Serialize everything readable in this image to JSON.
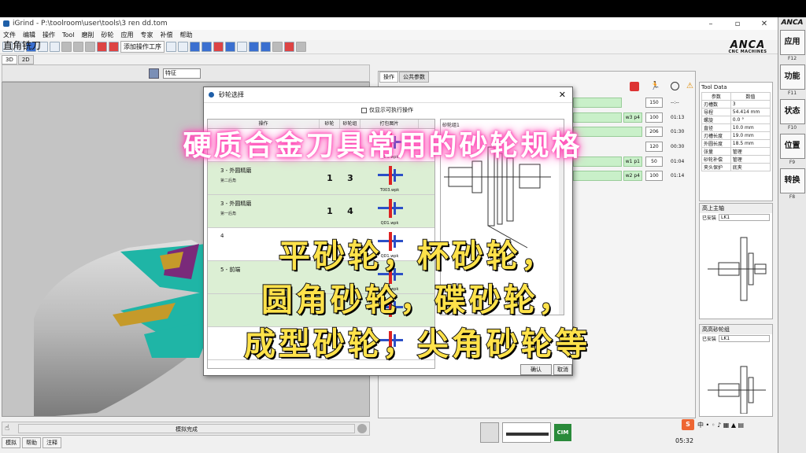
{
  "window": {
    "title": "iGrind - P:\\toolroom\\user\\tools\\3 ren dd.tom"
  },
  "menu": [
    "文件",
    "编辑",
    "操作",
    "Tool",
    "磨削",
    "砂轮",
    "应用",
    "专家",
    "补偿",
    "帮助"
  ],
  "toolbar": {
    "add_op_label": "添加操作工序"
  },
  "page_title": "直角铣刀",
  "brand": {
    "name": "ANCA",
    "sub": "CNC MACHINES"
  },
  "view_tabs": [
    "3D",
    "2D"
  ],
  "view": {
    "feature_select": "特征"
  },
  "sim_status": "模拟完成",
  "status_tabs": [
    "模拟",
    "帮助",
    "注释"
  ],
  "right_panel": {
    "tabs": [
      "操作",
      "公共参数"
    ],
    "rows": [
      {
        "label": "w3 p4",
        "num": "100",
        "time": "01:13"
      },
      {
        "label": "",
        "num": "206",
        "time": "01:30"
      },
      {
        "label": "",
        "num": "120",
        "time": "00:30"
      },
      {
        "label": "w1 p1",
        "num": "50",
        "time": "01:04"
      },
      {
        "label": "w2 p4",
        "num": "100",
        "time": "01:14"
      }
    ],
    "top_num": "150",
    "top_time": "--:--"
  },
  "tool_data": {
    "title": "Tool Data",
    "headers": [
      "参数",
      "数值"
    ],
    "rows": [
      [
        "刃槽数",
        "3"
      ],
      [
        "导程",
        "54.414 mm"
      ],
      [
        "螺旋",
        "0.0 °"
      ],
      [
        "直径",
        "10.0 mm"
      ],
      [
        "刃槽长度",
        "19.0 mm"
      ],
      [
        "外圆长度",
        "18.5 mm"
      ],
      [
        "张量",
        "管理"
      ],
      [
        "砂轮补偿",
        "管理"
      ],
      [
        "夹头保护",
        "底夹"
      ]
    ]
  },
  "spindle1": {
    "title": "高上主轴",
    "field_label": "已安装",
    "field_value": "LK1"
  },
  "spindle2": {
    "title": "高高砂轮组",
    "field_label": "已安装",
    "field_value": "LK1"
  },
  "side_buttons": [
    {
      "label": "应用",
      "key": "F12"
    },
    {
      "label": "功能",
      "key": "F11"
    },
    {
      "label": "状态",
      "key": "F10"
    },
    {
      "label": "位置",
      "key": "F9"
    },
    {
      "label": "转换",
      "key": "F8"
    }
  ],
  "clock": "05:32",
  "dialog": {
    "title": "砂轮选择",
    "checkbox_label": "仅显示可执行操作",
    "columns": [
      "操作",
      "砂轮",
      "砂轮组",
      "打包图片"
    ],
    "rows": [
      {
        "op": "",
        "sub": "",
        "wheel": "",
        "pack": "4",
        "file": "QD1.wpk",
        "green": false
      },
      {
        "op": "3 - 外圆精磨",
        "sub": "第二后角",
        "wheel": "1",
        "pack": "3",
        "file": "T003.wpk",
        "green": true
      },
      {
        "op": "3 - 外圆精磨",
        "sub": "第一后角",
        "wheel": "1",
        "pack": "4",
        "file": "QD1.wpk",
        "green": true
      },
      {
        "op": "4",
        "sub": "",
        "wheel": "",
        "pack": "",
        "file": "QD1.wpk",
        "green": false
      },
      {
        "op": "5 - 前端",
        "sub": "",
        "wheel": "",
        "pack": "",
        "file": "QD1.wpk",
        "green": true
      },
      {
        "op": "",
        "sub": "",
        "wheel": "",
        "pack": "",
        "file": "",
        "green": false
      },
      {
        "op": "",
        "sub": "",
        "wheel": "",
        "pack": "",
        "file": "",
        "green": false
      }
    ],
    "preview_label": "砂轮组1",
    "preview_file": "T001.wpk",
    "ok_label": "确认",
    "cancel_label": "取消"
  },
  "overlay": {
    "title": "硬质合金刀具常用的砂轮规格",
    "line1": "平砂轮，杯砂轮，",
    "line2": "圆角砂轮，碟砂轮，",
    "line3": "成型砂轮，尖角砂轮等"
  },
  "colors": {
    "accent_green": "#c9f0c9",
    "overlay_yellow": "#ffe24a",
    "overlay_pink_glow": "#ff4fb8"
  }
}
